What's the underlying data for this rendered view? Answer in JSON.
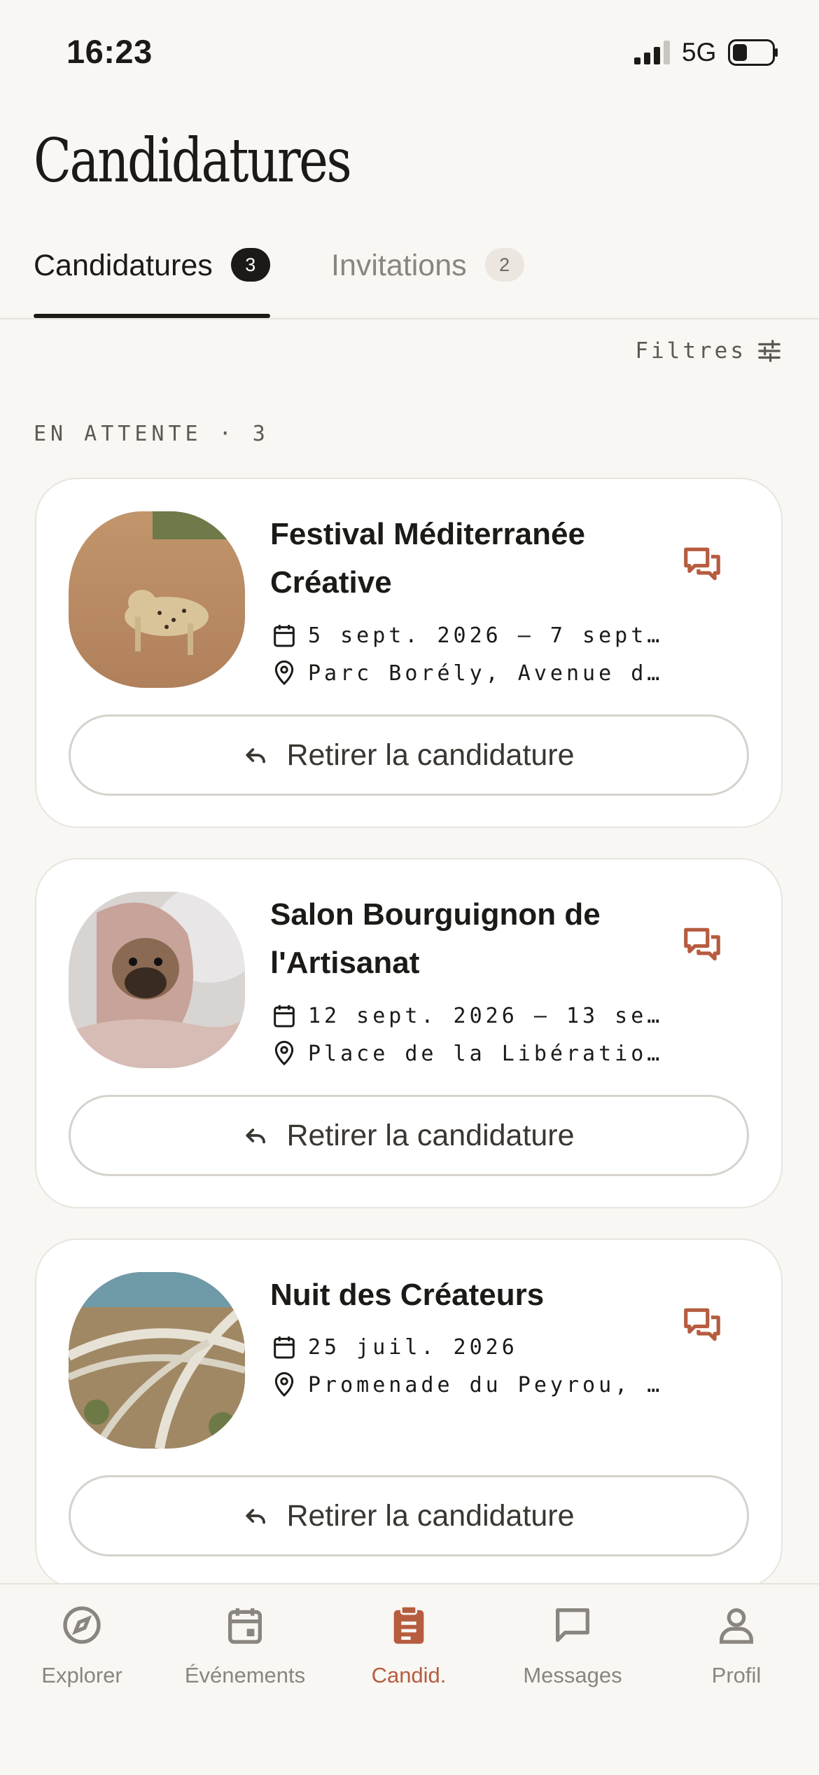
{
  "status_bar": {
    "time": "16:23",
    "network": "5G"
  },
  "page": {
    "title": "Candidatures"
  },
  "tabs": [
    {
      "label": "Candidatures",
      "count": "3",
      "active": true
    },
    {
      "label": "Invitations",
      "count": "2",
      "active": false
    }
  ],
  "filters": {
    "label": "Filtres",
    "icon": "sliders-icon"
  },
  "section": {
    "label": "EN ATTENTE · 3"
  },
  "cards": [
    {
      "title": "Festival Méditerranée Créative",
      "dates": "5 sept. 2026 – 7 sept…",
      "location": "Parc Borély, Avenue d…",
      "image": "leopard on dirt road",
      "action": "Retirer la candidature"
    },
    {
      "title": "Salon Bourguignon de l'Artisanat",
      "dates": "12 sept. 2026 – 13 se…",
      "location": "Place de la Libératio…",
      "image": "pug wrapped in blanket",
      "action": "Retirer la candidature"
    },
    {
      "title": "Nuit des Créateurs",
      "dates": "25 juil. 2026",
      "location": "Promenade du Peyrou, …",
      "image": "aerial highway interchange",
      "action": "Retirer la candidature"
    }
  ],
  "bottom_nav": [
    {
      "label": "Explorer",
      "icon": "compass-icon",
      "active": false
    },
    {
      "label": "Événements",
      "icon": "calendar-icon",
      "active": false
    },
    {
      "label": "Candid.",
      "icon": "clipboard-icon",
      "active": true
    },
    {
      "label": "Messages",
      "icon": "message-icon",
      "active": false
    },
    {
      "label": "Profil",
      "icon": "person-icon",
      "active": false
    }
  ],
  "colors": {
    "accent": "#b65c3f",
    "background": "#f9f7f4",
    "text": "#1c1a17"
  }
}
